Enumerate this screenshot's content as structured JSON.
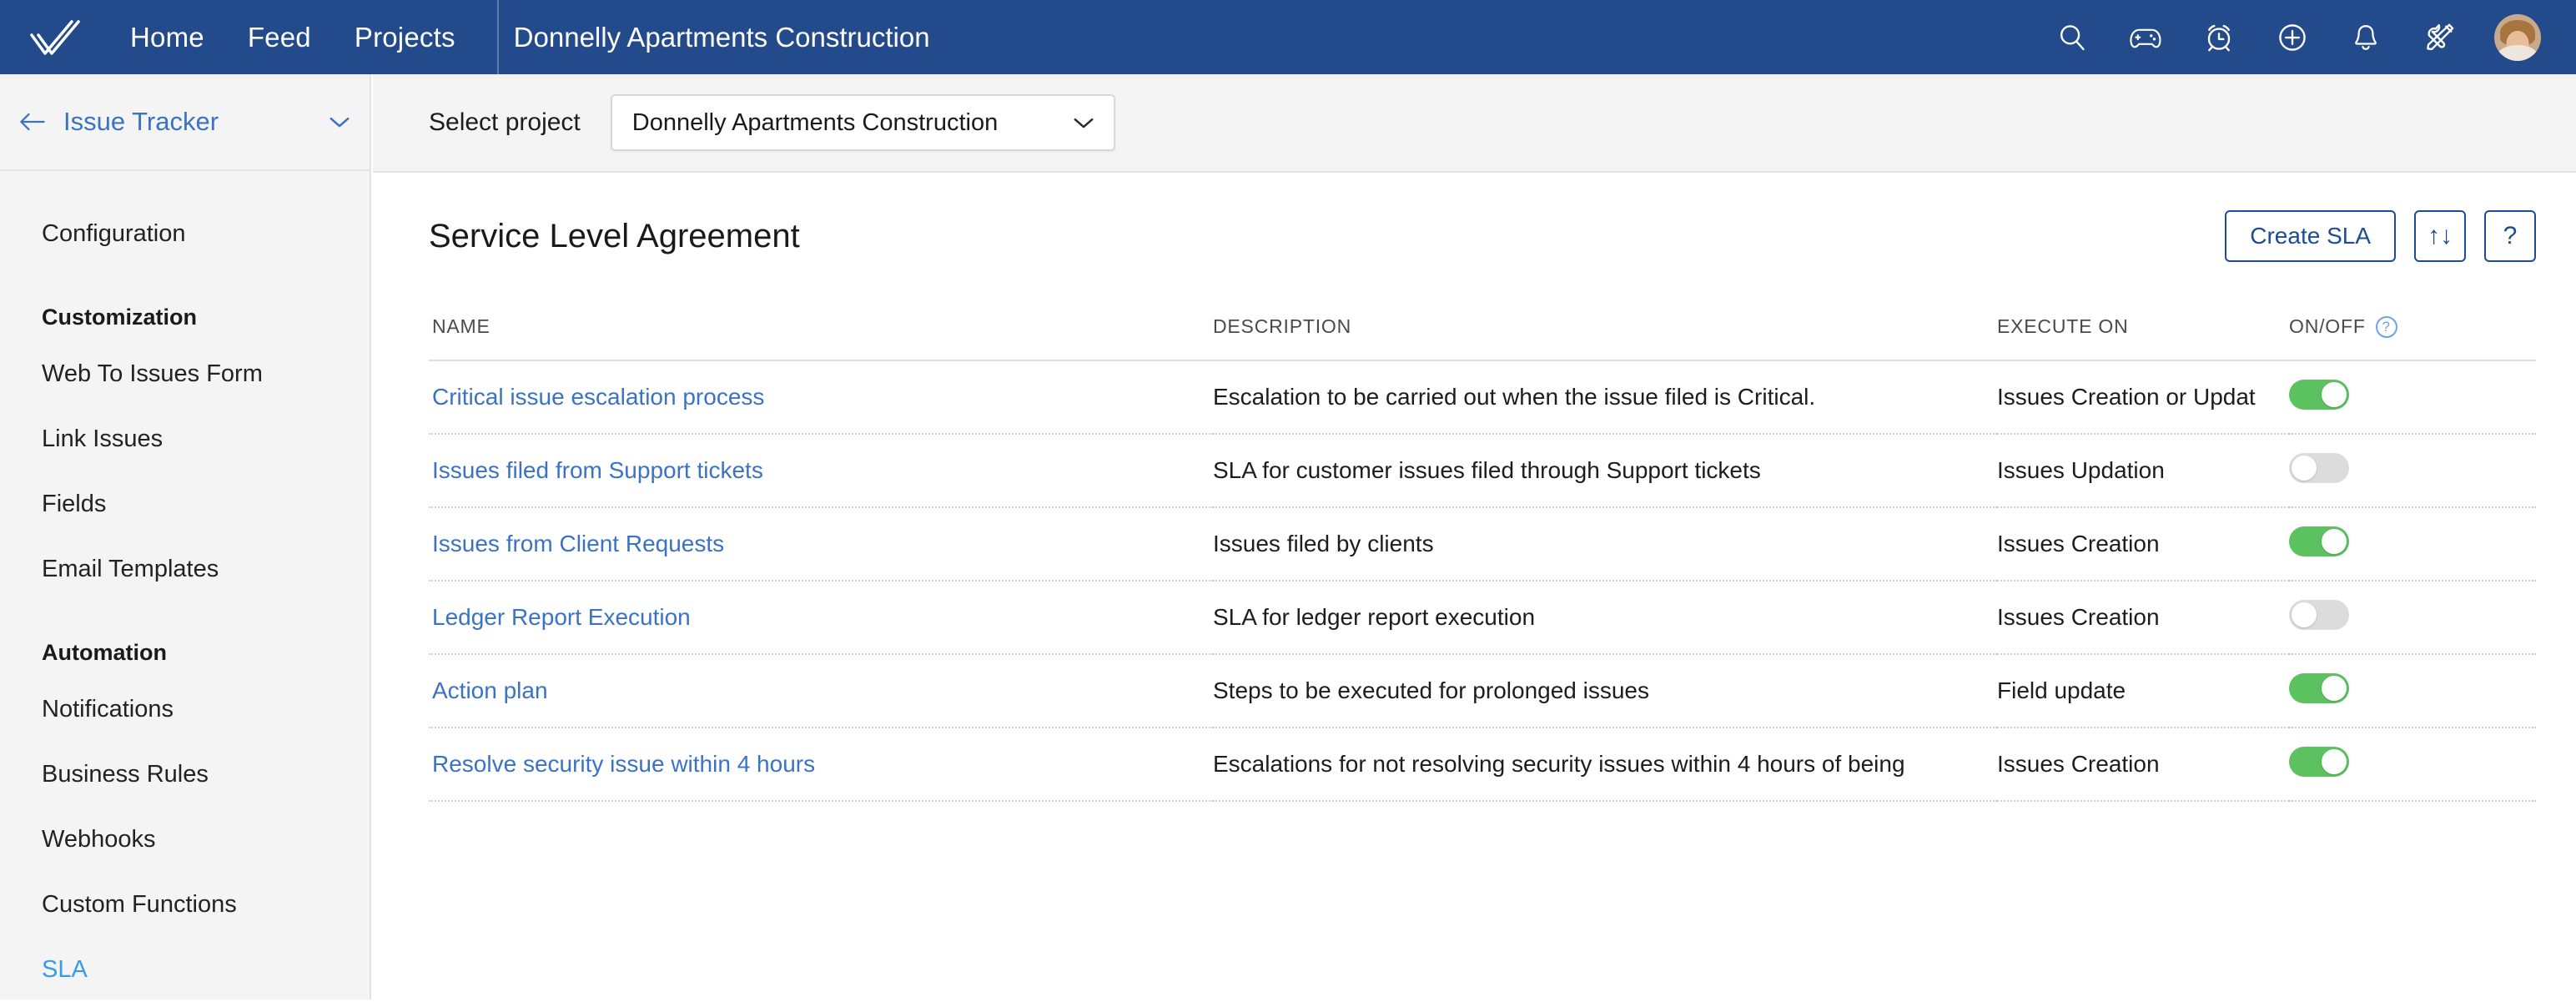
{
  "topbar": {
    "logo_icon": "double-check-logo",
    "nav": [
      {
        "label": "Home"
      },
      {
        "label": "Feed"
      },
      {
        "label": "Projects"
      }
    ],
    "project_title": "Donnelly Apartments Construction",
    "icons": [
      {
        "name": "search-icon"
      },
      {
        "name": "game-controller-icon"
      },
      {
        "name": "alarm-clock-icon"
      },
      {
        "name": "plus-circle-icon"
      },
      {
        "name": "bell-icon"
      },
      {
        "name": "tools-icon"
      }
    ],
    "avatar_alt": "user-avatar"
  },
  "sidebar": {
    "header_title": "Issue Tracker",
    "back_icon": "back-arrow-icon",
    "caret_icon": "chevron-down-icon",
    "items": [
      {
        "label": "Configuration",
        "type": "item",
        "active": false
      },
      {
        "label": "Customization",
        "type": "group"
      },
      {
        "label": "Web To Issues Form",
        "type": "item",
        "active": false
      },
      {
        "label": "Link Issues",
        "type": "item",
        "active": false
      },
      {
        "label": "Fields",
        "type": "item",
        "active": false
      },
      {
        "label": "Email Templates",
        "type": "item",
        "active": false
      },
      {
        "label": "Automation",
        "type": "group"
      },
      {
        "label": "Notifications",
        "type": "item",
        "active": false
      },
      {
        "label": "Business Rules",
        "type": "item",
        "active": false
      },
      {
        "label": "Webhooks",
        "type": "item",
        "active": false
      },
      {
        "label": "Custom Functions",
        "type": "item",
        "active": false
      },
      {
        "label": "SLA",
        "type": "item",
        "active": true
      }
    ]
  },
  "selectbar": {
    "label": "Select project",
    "selected_project": "Donnelly Apartments Construction",
    "caret_icon": "chevron-down-icon"
  },
  "main": {
    "page_title": "Service Level Agreement",
    "create_button": "Create SLA",
    "sort_button_glyph": "↑↓",
    "help_button_glyph": "?",
    "table": {
      "columns": [
        "NAME",
        "DESCRIPTION",
        "EXECUTE ON",
        "ON/OFF"
      ],
      "onoff_help_glyph": "?",
      "rows": [
        {
          "name": "Critical issue escalation process",
          "description": "Escalation to be carried out when the issue filed is Critical.",
          "execute_on": "Issues Creation or Updat",
          "enabled": true
        },
        {
          "name": "Issues filed from Support tickets",
          "description": "SLA for customer issues filed through Support tickets",
          "execute_on": "Issues Updation",
          "enabled": false
        },
        {
          "name": "Issues from Client Requests",
          "description": "Issues filed by clients",
          "execute_on": "Issues Creation",
          "enabled": true
        },
        {
          "name": "Ledger Report Execution",
          "description": "SLA for ledger report execution",
          "execute_on": "Issues Creation",
          "enabled": false
        },
        {
          "name": "Action plan",
          "description": "Steps to be executed for prolonged issues",
          "execute_on": "Field update",
          "enabled": true
        },
        {
          "name": "Resolve security issue within 4 hours",
          "description": "Escalations for not resolving security issues within 4 hours of being",
          "execute_on": "Issues Creation",
          "enabled": true
        }
      ]
    }
  },
  "colors": {
    "topbar_blue": "#234a8a",
    "link_blue": "#3b73c4",
    "active_blue": "#3b9ae8",
    "toggle_on_green": "#5bc25f",
    "toggle_off_gray": "#dcdcdc",
    "sidebar_bg": "#f4f4f4"
  }
}
